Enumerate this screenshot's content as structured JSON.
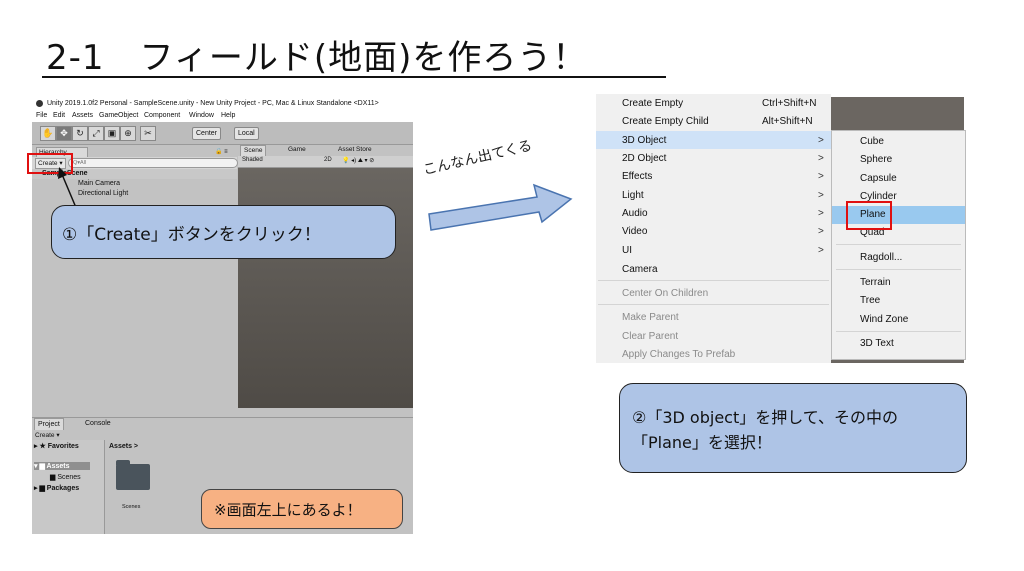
{
  "slide": {
    "title": "2-1　フィールド(地面)を作ろう！"
  },
  "unity": {
    "window_title": "Unity 2019.1.0f2 Personal - SampleScene.unity - New Unity Project - PC, Mac & Linux Standalone <DX11>",
    "menu": [
      "File",
      "Edit",
      "Assets",
      "GameObject",
      "Component",
      "Window",
      "Help"
    ],
    "toolbar": {
      "center": "Center",
      "local": "Local"
    },
    "hierarchy": {
      "tab": "Hierarchy",
      "create": "Create ▾",
      "search_placeholder": "Q▾All",
      "scene": "SampleScene",
      "items": [
        "Main Camera",
        "Directional Light"
      ]
    },
    "scene_tabs": {
      "scene": "Scene",
      "game": "Game",
      "asset_store": "Asset Store"
    },
    "scene_bar": {
      "shading": "Shaded",
      "mode": "2D"
    },
    "project": {
      "tab_project": "Project",
      "tab_console": "Console",
      "create": "Create ▾",
      "favorites": "Favorites",
      "assets": "Assets",
      "scenes": "Scenes",
      "packages": "Packages",
      "breadcrumb": "Assets >",
      "folder_label": "Scenes"
    }
  },
  "callouts": {
    "step1": "①「Create」ボタンをクリック！",
    "step2_line1": "②「3D object」を押して、その中の",
    "step2_line2": "「Plane」を選択！",
    "note": "※画面左上にあるよ！",
    "arrow_label": "こんなん出てくる"
  },
  "context_menu": {
    "items": [
      {
        "label": "Create Empty",
        "shortcut": "Ctrl+Shift+N"
      },
      {
        "label": "Create Empty Child",
        "shortcut": "Alt+Shift+N"
      },
      {
        "label": "3D Object",
        "arrow": ">"
      },
      {
        "label": "2D Object",
        "arrow": ">"
      },
      {
        "label": "Effects",
        "arrow": ">"
      },
      {
        "label": "Light",
        "arrow": ">"
      },
      {
        "label": "Audio",
        "arrow": ">"
      },
      {
        "label": "Video",
        "arrow": ">"
      },
      {
        "label": "UI",
        "arrow": ">"
      },
      {
        "label": "Camera"
      },
      {
        "label": "Center On Children"
      },
      {
        "label": "Make Parent"
      },
      {
        "label": "Clear Parent"
      },
      {
        "label": "Apply Changes To Prefab"
      }
    ],
    "submenu": [
      "Cube",
      "Sphere",
      "Capsule",
      "Cylinder",
      "Plane",
      "Quad",
      "Ragdoll...",
      "Terrain",
      "Tree",
      "Wind Zone",
      "3D Text"
    ]
  },
  "colors": {
    "callout_blue": "#aec4e6",
    "note_orange": "#f7b183",
    "highlight_red": "#e01010"
  }
}
